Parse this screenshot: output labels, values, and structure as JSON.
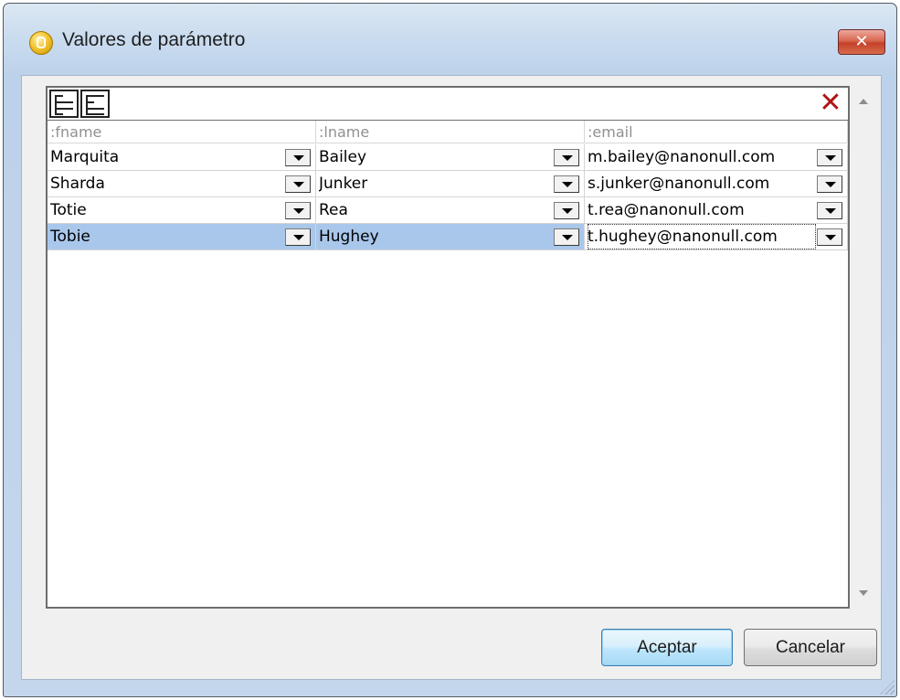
{
  "window": {
    "title": "Valores de parámetro",
    "close_label": "✕"
  },
  "toolbar": {
    "delete_label": "✕"
  },
  "table": {
    "columns": [
      ":fname",
      ":lname",
      ":email"
    ],
    "rows": [
      [
        "Marquita",
        "Bailey",
        "m.bailey@nanonull.com"
      ],
      [
        "Sharda",
        "Junker",
        "s.junker@nanonull.com"
      ],
      [
        "Totie",
        "Rea",
        "t.rea@nanonull.com"
      ],
      [
        "Tobie",
        "Hughey",
        "t.hughey@nanonull.com"
      ]
    ],
    "selected_row": 4
  },
  "buttons": {
    "ok_label": "Aceptar",
    "cancel_label": "Cancelar"
  },
  "colors": {
    "selection": "#a9c7eb",
    "delete_icon": "#b01414",
    "header_text": "#909090"
  }
}
